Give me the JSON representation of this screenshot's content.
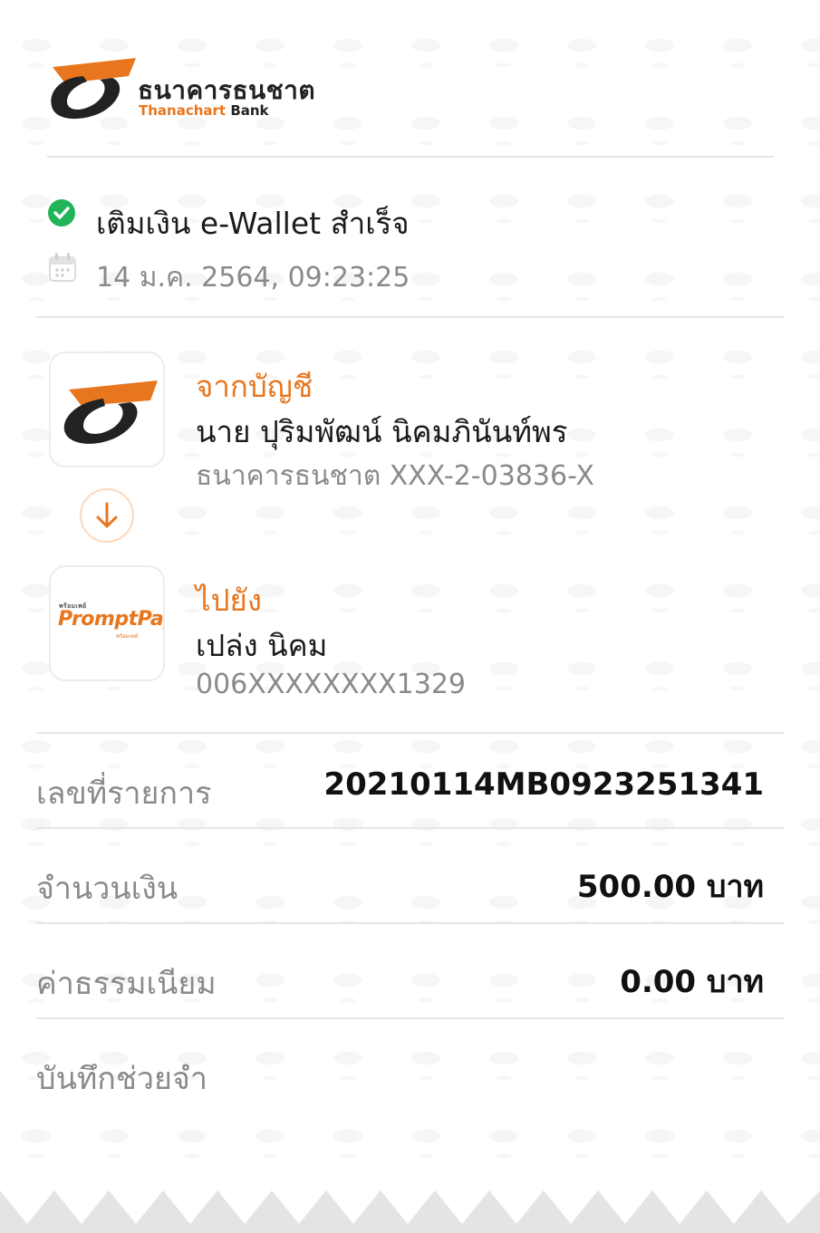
{
  "bank": {
    "name_th": "ธนาคารธนชาต",
    "name_en_orange": "Thanachart",
    "name_en_dark": "Bank"
  },
  "status": {
    "text": "เติมเงิน e-Wallet สำเร็จ",
    "datetime": "14 ม.ค. 2564, 09:23:25",
    "color": "#22b458"
  },
  "from": {
    "label": "จากบัญชี",
    "name": "นาย ปุริมพัฒน์ นิคมภินันท์พร",
    "account": "ธนาคารธนชาต XXX-2-03836-X"
  },
  "to": {
    "label": "ไปยัง",
    "name": "เปล่ง นิคม",
    "account": "006XXXXXXXX1329",
    "logo_small": "พร้อมเพย์",
    "logo_main": "PromptPay",
    "logo_tag": "พร้อมเพย์"
  },
  "details": {
    "ref_label": "เลขที่รายการ",
    "ref_value": "20210114MB0923251341",
    "amount_label": "จำนวนเงิน",
    "amount_value": "500.00 บาท",
    "fee_label": "ค่าธรรมเนียม",
    "fee_value": "0.00 บาท",
    "memo_label": "บันทึกช่วยจำ"
  },
  "colors": {
    "brand_orange": "#e8761e",
    "brand_dark": "#222222",
    "muted_text": "#8a8a8a"
  },
  "icons": [
    "thanachart-logo",
    "check-circle-icon",
    "calendar-icon",
    "arrow-down-icon",
    "promptpay-logo"
  ]
}
